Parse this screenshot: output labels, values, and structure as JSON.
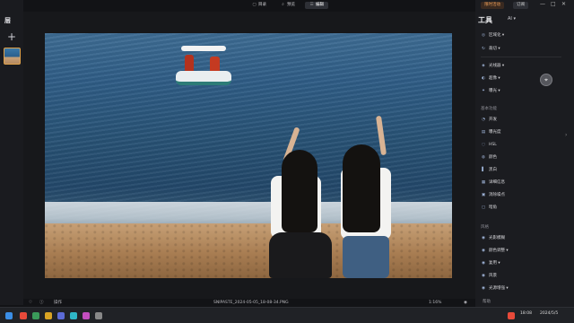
{
  "left_panel": {
    "title": "层",
    "add_label": "+"
  },
  "top_tabs": [
    {
      "icon": "▢",
      "label": "目录"
    },
    {
      "icon": "⌕",
      "label": "预览"
    },
    {
      "icon": "☰",
      "label": "编辑"
    }
  ],
  "bottom_bar": {
    "heart_icon": "♡",
    "info_icon": "ⓘ",
    "ops_label": "操作",
    "filename": "SNIPASTE_2024-05-05_18-08-34.PNG",
    "zoom": "1:16%",
    "eye_icon": "◉",
    "help": "帮助"
  },
  "right_panel": {
    "top_buttons": {
      "promo": "限时活动",
      "sub": "订阅"
    },
    "window_controls": [
      "—",
      "□",
      "✕"
    ],
    "title": "工具",
    "ai_label": "AI ▾",
    "tools_top": [
      {
        "icon": "◎",
        "label": "区域化 ▾"
      },
      {
        "icon": "↻",
        "label": "裁切 ▾"
      }
    ],
    "tools_mid": [
      {
        "icon": "◈",
        "label": "光线器 ▾"
      },
      {
        "icon": "◐",
        "label": "超像 ▾"
      },
      {
        "icon": "✦",
        "label": "曝光 ▾"
      }
    ],
    "section_basic": "基本功能",
    "tools_basic": [
      {
        "icon": "◔",
        "label": "开发"
      },
      {
        "icon": "▤",
        "label": "曝光度"
      },
      {
        "icon": "◌",
        "label": "HSL"
      },
      {
        "icon": "◍",
        "label": "颜色"
      },
      {
        "icon": "▌",
        "label": "黑白"
      },
      {
        "icon": "▦",
        "label": "详细信息"
      },
      {
        "icon": "▣",
        "label": "消除噪点"
      },
      {
        "icon": "▢",
        "label": "暗角"
      }
    ],
    "section_style": "风格",
    "tools_style": [
      {
        "icon": "◉",
        "label": "光影模糊"
      },
      {
        "icon": "◉",
        "label": "颜色调整 ▾"
      },
      {
        "icon": "◉",
        "label": "复用 ▾"
      },
      {
        "icon": "◉",
        "label": "风景"
      },
      {
        "icon": "◉",
        "label": "光源增强 ▾"
      }
    ],
    "assistant_icon": "⌖"
  },
  "taskbar": {
    "tray_time": "18:08",
    "tray_date": "2024/5/5"
  },
  "colors": {
    "accent": "#f0a15a",
    "panel": "#1b1c20",
    "canvas": "#17181b"
  }
}
